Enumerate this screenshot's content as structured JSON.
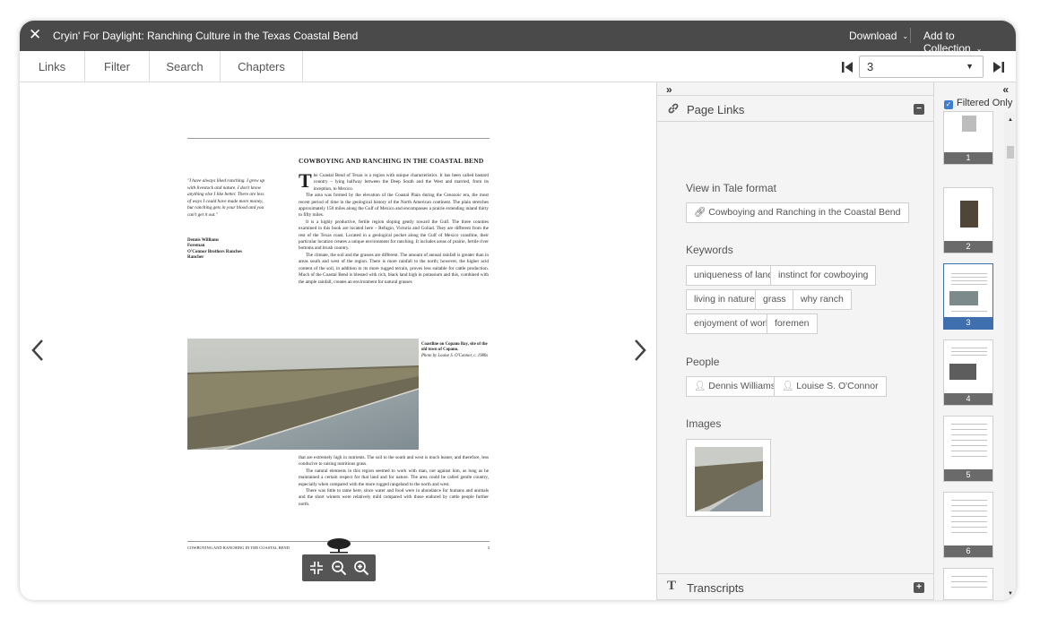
{
  "window": {
    "title": "Cryin' For Daylight: Ranching Culture in the Texas Coastal Bend",
    "download_label": "Download",
    "collection_label": "Add to Collection"
  },
  "toolbar": {
    "tabs": [
      "Links",
      "Filter",
      "Search",
      "Chapters"
    ],
    "page_value": "3"
  },
  "document": {
    "heading": "COWBOYING AND RANCHING IN THE COASTAL BEND",
    "quote": "\"I have always liked ranching. I grew up with livestock and nature. I don't know anything else I like better. There are less of ways I could have made more money, but ranching gets in your blood and you can't get it out.\"",
    "credit_name": "Dennis Williams",
    "credit_role": "Foreman",
    "credit_org": "O'Connor Brothers Ranches",
    "credit_org2": "Rancher",
    "dropcap": "T",
    "para1": "he Coastal Bend of Texas is a region with unique characteristics. It has been called bastard country – lying halfway between the Deep South and the West and married, from its inception, to Mexico.",
    "para2": "The area was formed by the elevation of the Coastal Plain during the Cenozoic era, the most recent period of time in the geological history of the North American continent. The plain stretches approximately 150 miles along the Gulf of Mexico and encompasses a prairie extending inland thirty to fifty miles.",
    "para3": "It is a highly productive, fertile region sloping gently toward the Gulf. The three counties examined in this book are located here – Refugio, Victoria and Goliad. They are different from the rest of the Texas coast. Located in a geological pocket along the Gulf of Mexico coastline, their particular location creates a unique environment for ranching. It includes areas of prairie, fertile river bottoms and brush country.",
    "para4": "The climate, the soil and the grasses are different. The amount of annual rainfall is greater than in areas south and west of the region. There is more rainfall to the north; however, the higher acid content of the soil, in addition to its more rugged terrain, proves less suitable for cattle production. Much of the Coastal Bend is blessed with rich, black land high in potassium and this, combined with the ample rainfall, creates an environment for natural grasses",
    "caption_bold": "Coastline on Copano Bay, site of the old town of Copano.",
    "caption_italic": "Photo by Louise S. O'Connor, c. 1980s",
    "para5": "that are extremely high in nutrients. The soil to the south and west is much leaner, and therefore, less conducive to raising nutritious grass.",
    "para6": "The natural elements in this region seemed to work with man, not against him, as long as he maintained a certain respect for that land and for nature. The area could be called gentle country, especially when compared with the more rugged rangeland to the north and west.",
    "para7": "There was little to tame here, since water and food were in abundance for humans and animals and the short winters were relatively mild compared with those endured by cattle people further north.",
    "footer_left": "COWBOYING AND RANCHING IN THE COASTAL BEND",
    "footer_right": "3"
  },
  "right_panel": {
    "page_links_title": "Page Links",
    "tale_label": "View in Tale format",
    "tale_link": "Cowboying and Ranching in the Coastal Bend",
    "keywords_label": "Keywords",
    "keywords": [
      "uniqueness of land",
      "instinct for cowboying",
      "living in nature",
      "grass",
      "why ranch",
      "enjoyment of work",
      "foremen"
    ],
    "people_label": "People",
    "people": [
      "Dennis Williams",
      "Louise S. O'Connor"
    ],
    "images_label": "Images",
    "transcripts_title": "Transcripts"
  },
  "thumbnails": {
    "filtered_only_label": "Filtered Only",
    "pages": [
      "1",
      "2",
      "3",
      "4",
      "5",
      "6"
    ],
    "selected": "3"
  }
}
